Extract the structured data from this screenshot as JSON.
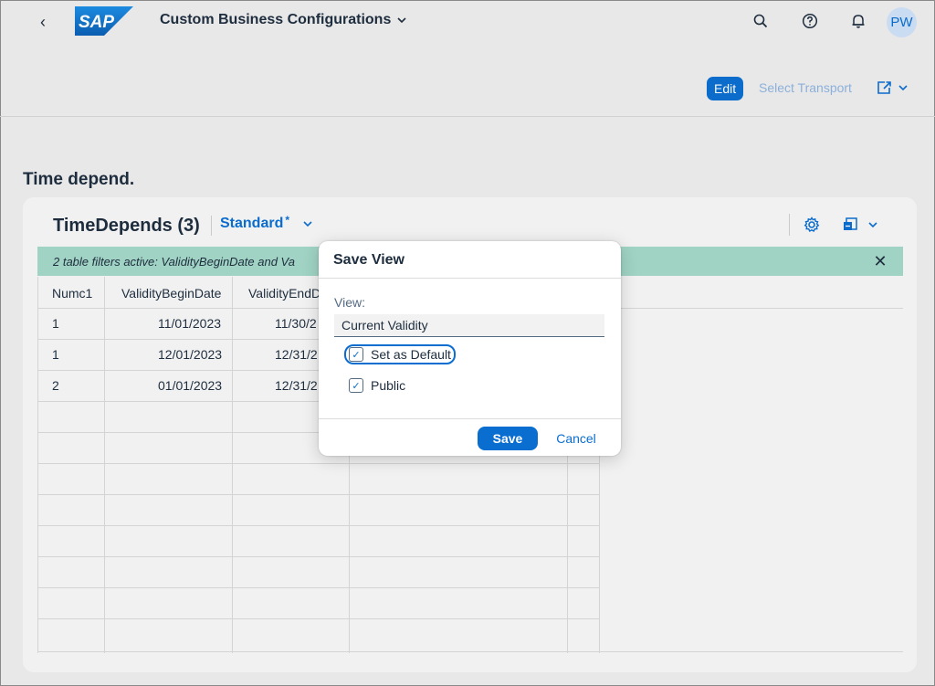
{
  "shell": {
    "logo_text": "SAP",
    "app_title": "Custom Business Configurations",
    "avatar_initials": "PW"
  },
  "header_toolbar": {
    "edit_label": "Edit",
    "select_transport_label": "Select Transport"
  },
  "section": {
    "title": "Time depend."
  },
  "table": {
    "title": "TimeDepends (3)",
    "variant": "Standard",
    "variant_modified": "*",
    "filter_message": "2 table filters active: ValidityBeginDate and Va",
    "columns": [
      "Numc1",
      "ValidityBeginDate",
      "ValidityEndD"
    ],
    "rows": [
      [
        "1",
        "11/01/2023",
        "11/30/2"
      ],
      [
        "1",
        "12/01/2023",
        "12/31/2"
      ],
      [
        "2",
        "01/01/2023",
        "12/31/2"
      ]
    ]
  },
  "dialog": {
    "title": "Save View",
    "view_label": "View:",
    "view_value": "Current Validity",
    "set_default_label": "Set as Default",
    "set_default_checked": true,
    "public_label": "Public",
    "public_checked": true,
    "save_label": "Save",
    "cancel_label": "Cancel"
  },
  "icons": {
    "back": "chevron-left-icon",
    "search": "search-icon",
    "help": "help-icon",
    "notifications": "bell-icon",
    "share": "share-icon",
    "settings": "gear-icon",
    "export": "export-icon",
    "close": "close-icon"
  },
  "colors": {
    "accent": "#0a6ed1",
    "filter_bar": "#a4d8c9",
    "background": "#eeeeee"
  }
}
